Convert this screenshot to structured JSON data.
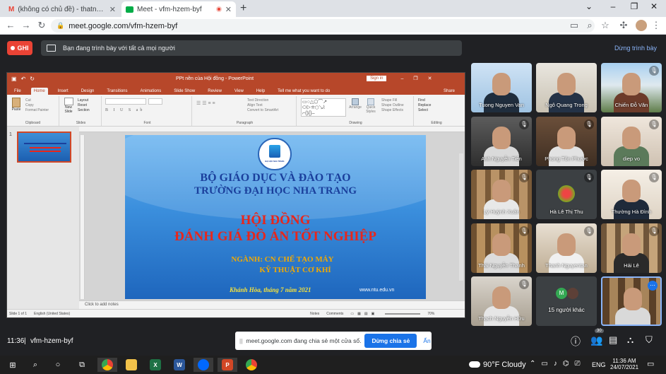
{
  "browser": {
    "tabs": [
      {
        "title": "(không có chủ đề) - thatnh@ntu.e",
        "icon": "gmail-icon"
      },
      {
        "title": "Meet - vfm-hzem-byf",
        "icon": "meet-icon",
        "recording": true
      }
    ],
    "url": "meet.google.com/vfm-hzem-byf"
  },
  "meet": {
    "record_label": "GHI",
    "presenting_msg": "Bạn đang trình bày với tất cả mọi người",
    "stop_presenting": "Dừng trình bày",
    "time": "11:36",
    "meeting_code": "vfm-hzem-byf",
    "share_msg": "meet.google.com đang chia sẻ một cửa sổ.",
    "stop_share": "Dừng chia sẻ",
    "hide": "Ẩn",
    "participant_count": "30",
    "others_label": "15 người khác",
    "participants": [
      {
        "name": "Tuong Nguyen Van",
        "muted": false
      },
      {
        "name": "Ngô Quang Trong",
        "muted": false
      },
      {
        "name": "Chiến Đỗ Văn",
        "muted": true
      },
      {
        "name": "Anh Nguyễn Tiến",
        "muted": true
      },
      {
        "name": "Phong Tôn Phước",
        "muted": true
      },
      {
        "name": "diep vo",
        "muted": true
      },
      {
        "name": "Lý Huỳnh Xuân",
        "muted": true
      },
      {
        "name": "Hà Lê Thị Thu",
        "muted": true
      },
      {
        "name": "Thường Hà Đình",
        "muted": true
      },
      {
        "name": "Thái Nguyễn Thanh",
        "muted": true
      },
      {
        "name": "Thanh Nguyentan",
        "muted": true
      },
      {
        "name": "Hải Lê",
        "muted": true
      },
      {
        "name": "Thạch Nguyễn Hữu",
        "muted": true
      }
    ]
  },
  "ppt": {
    "title": "PPt nền của Hội đồng - PowerPoint",
    "signin": "Sign in",
    "tabs": [
      "File",
      "Home",
      "Insert",
      "Design",
      "Transitions",
      "Animations",
      "Slide Show",
      "Review",
      "View",
      "Help"
    ],
    "tell_me": "Tell me what you want to do",
    "share": "Share",
    "groups": {
      "clipboard": "Clipboard",
      "slides": "Slides",
      "font": "Font",
      "paragraph": "Paragraph",
      "drawing": "Drawing",
      "editing": "Editing"
    },
    "clip_items": [
      "Cut",
      "Copy",
      "Format Painter"
    ],
    "paste": "Paste",
    "new_slide": "New Slide",
    "slide_items": [
      "Layout",
      "Reset",
      "Section"
    ],
    "para_items": [
      "Text Direction",
      "Align Text",
      "Convert to SmartArt"
    ],
    "draw_items": [
      "Arrange",
      "Quick Styles",
      "Shape Fill",
      "Shape Outline",
      "Shape Effects"
    ],
    "edit_items": [
      "Find",
      "Replace",
      "Select"
    ],
    "notes_placeholder": "Click to add notes",
    "status": {
      "slide": "Slide 1 of 1",
      "lang": "English (United States)",
      "notes": "Notes",
      "comments": "Comments",
      "zoom": "70%"
    },
    "slide": {
      "logo_text": "ĐẠI HỌC NHA TRANG",
      "ministry": "BỘ GIÁO DỤC VÀ ĐÀO TẠO",
      "university": "TRƯỜNG ĐẠI HỌC NHA TRANG",
      "council": "HỘI ĐỒNG",
      "purpose": "ĐÁNH GIÁ ĐỒ ÁN TỐT NGHIỆP",
      "major_line1": "NGÀNH: CN CHẾ TẠO MÁY",
      "major_line2": "KỸ THUẬT CƠ KHÍ",
      "place_date": "Khánh Hòa, tháng 7 năm 2021",
      "website": "www.ntu.edu.vn"
    }
  },
  "taskbar": {
    "weather": "90°F  Cloudy",
    "lang": "ENG",
    "time": "11:36 AM",
    "date": "24/07/2021"
  },
  "colors": {
    "ppt_red": "#b7472a",
    "slide_title_blue": "#1a3f9c",
    "slide_title_red": "#e8261b",
    "slide_orange": "#f2a900",
    "slide_yellow": "#f6e23a",
    "meet_blue": "#1a73e8",
    "record_red": "#ea4335"
  }
}
